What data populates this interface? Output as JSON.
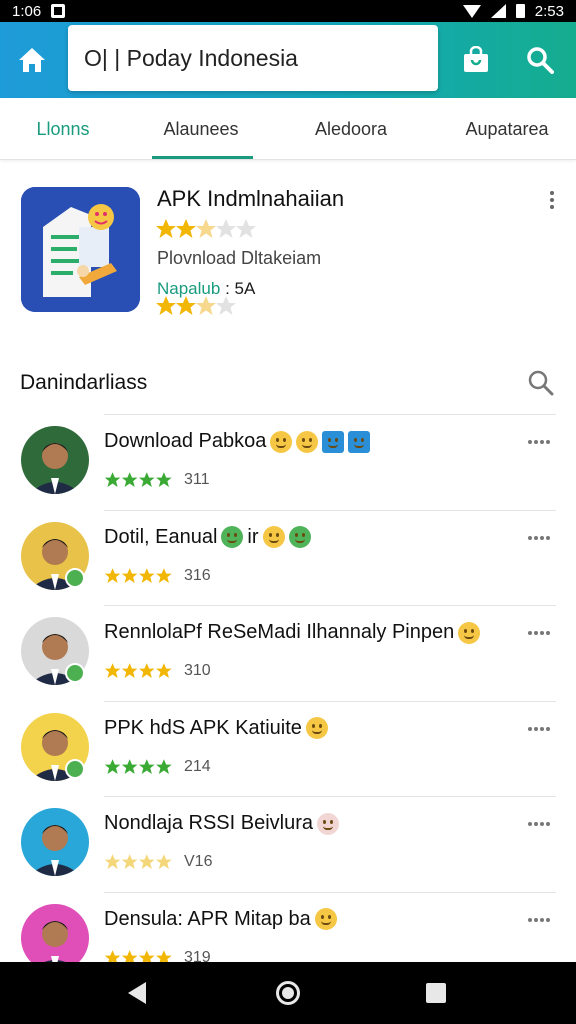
{
  "status_bar": {
    "time": "1:06",
    "battery_time": "2:53"
  },
  "search": {
    "value": "O| | Poday Indonesia"
  },
  "tabs": [
    {
      "label": "Llonns"
    },
    {
      "label": "Alaunees"
    },
    {
      "label": "Aledoora"
    },
    {
      "label": "Aupatarea"
    }
  ],
  "featured": {
    "title": "APK Indmlnahaiian",
    "subtitle": "Plovnload Dltakeiam",
    "meta_label": "Napalub",
    "meta_value": ": 5A",
    "rating_1": 2.5,
    "rating_2": 2.5
  },
  "section": {
    "title": "Danindarliass"
  },
  "list": [
    {
      "title": "Download Pabkoa",
      "emojis": [
        "yellow",
        "yellow",
        "blue",
        "blue"
      ],
      "rating_text": "311",
      "stars": 4,
      "star_color": "#3aaa35",
      "avatar_bg": "#2f6b3a",
      "badge": false
    },
    {
      "title": "Dotil, Eanual",
      "emojis": [
        "green",
        "yellow",
        "green"
      ],
      "mid_text": "ir",
      "rating_text": "316",
      "stars": 4,
      "star_color": "#f2b705",
      "avatar_bg": "#e9c24a",
      "badge": true
    },
    {
      "title": "RennlolaPf ReSeMadi Ilhannaly Pinpen",
      "emojis": [
        "yellow"
      ],
      "rating_text": "310",
      "stars": 4,
      "star_color": "#f2b705",
      "avatar_bg": "#d9d9d9",
      "badge": true
    },
    {
      "title": "PPK hdS APK Katiuite",
      "emojis": [
        "yellow"
      ],
      "rating_text": "214",
      "stars": 4,
      "star_color": "#3aaa35",
      "avatar_bg": "#f3d24c",
      "badge": true
    },
    {
      "title": "Nondlaja RSSI Beivlura",
      "emojis": [
        "pale"
      ],
      "rating_text": "V16",
      "stars": 4,
      "star_color": "#f4d77a",
      "avatar_bg": "#2aa7d9",
      "badge": false
    },
    {
      "title": "Densula: APR Mitap ba",
      "emojis": [
        "yellow"
      ],
      "rating_text": "319",
      "stars": 4,
      "star_color": "#f2b705",
      "avatar_bg": "#e04fb8",
      "badge": false
    }
  ],
  "colors": {
    "accent": "#1a9b7e",
    "app_bar_start": "#1e9bd9",
    "app_bar_end": "#15ad8f",
    "feature_icon": "#2a4fb4"
  }
}
